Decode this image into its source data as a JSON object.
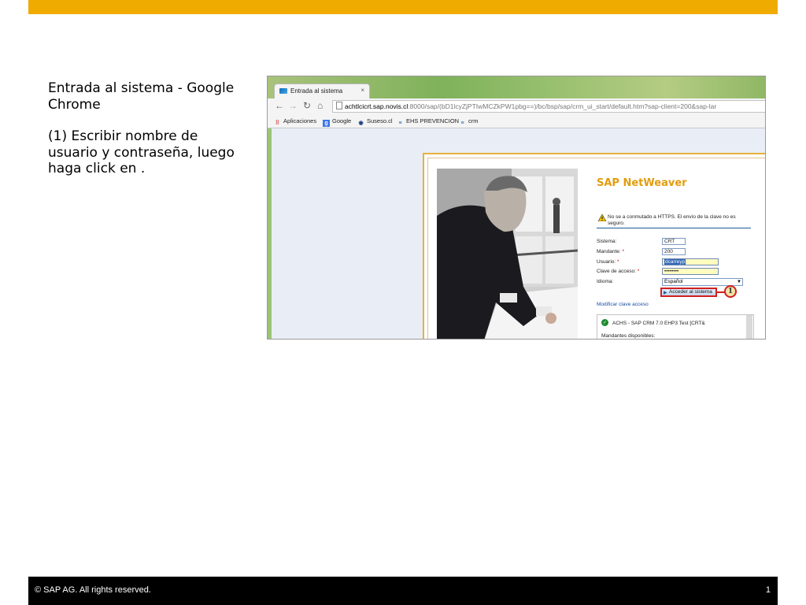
{
  "slide": {
    "title_line": "Entrada al sistema - Google Chrome",
    "instruction": "(1) Escribir nombre de usuario y contraseña, luego haga click en .",
    "footer_text": "© SAP AG. All rights reserved.",
    "page_number": "1",
    "colors": {
      "top_bar": "#f0ab00",
      "footer": "#000000"
    }
  },
  "browser": {
    "tab_title": "Entrada al sistema",
    "tab_close": "×",
    "url_host": "achtlcicrt.sap.novis.cl",
    "url_path": ":8000/sap/(bD1lcyZjPTIwMCZkPW1pbg==)/bc/bsp/sap/crm_ui_start/default.htm?sap-client=200&sap-lar",
    "bookmarks": [
      "Aplicaciones",
      "Google",
      "Suseso.cl",
      "EHS PREVENCION",
      "crm"
    ]
  },
  "login": {
    "brand": "SAP NetWeaver",
    "warning": "No se a conmutado a HTTPS. El envío de la clave no es seguro.",
    "labels": {
      "system": "Sistema:",
      "client": "Mandante:",
      "user": "Usuario:",
      "password": "Clave de acceso:",
      "language": "Idioma:"
    },
    "required_mark": "*",
    "values": {
      "system": "CRT",
      "client": "200",
      "user": "dcarreyp",
      "password": "••••••••",
      "language": "Español"
    },
    "login_button": "Acceder al sistema",
    "callout_number": "1",
    "change_password_link": "Modificar clave acceso",
    "system_entry": "ACHS - SAP CRM 7.0 EHP3 Test [CRT&",
    "clients_label": "Mandantes disponibles:"
  }
}
